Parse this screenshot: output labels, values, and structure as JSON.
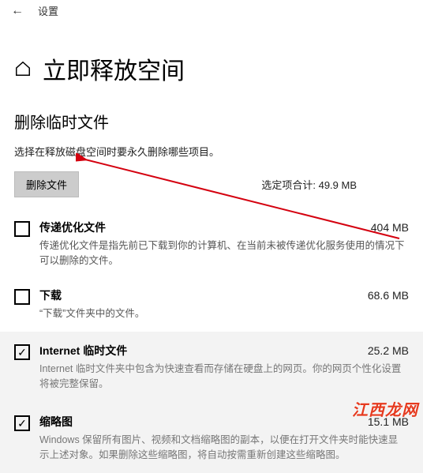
{
  "header": {
    "settings_label": "设置"
  },
  "page": {
    "title": "立即释放空间"
  },
  "section": {
    "title": "删除临时文件",
    "subtitle": "选择在释放磁盘空间时要永久删除哪些项目。",
    "delete_button": "删除文件",
    "selected_total_label": "选定项合计: 49.9 MB"
  },
  "items": [
    {
      "title": "传递优化文件",
      "size": "404 MB",
      "desc": "传递优化文件是指先前已下载到你的计算机、在当前未被传递优化服务使用的情况下可以删除的文件。",
      "checked": false
    },
    {
      "title": "下载",
      "size": "68.6 MB",
      "desc": "“下载”文件夹中的文件。",
      "checked": false
    },
    {
      "title": "Internet 临时文件",
      "size": "25.2 MB",
      "desc": "Internet 临时文件夹中包含为快速查看而存储在硬盘上的网页。你的网页个性化设置将被完整保留。",
      "checked": true
    },
    {
      "title": "缩略图",
      "size": "15.1 MB",
      "desc": "Windows 保留所有图片、视频和文档缩略图的副本，以便在打开文件夹时能快速显示上述对象。如果删除这些缩略图，将自动按需重新创建这些缩略图。",
      "checked": true
    }
  ],
  "watermark": "江西龙网"
}
